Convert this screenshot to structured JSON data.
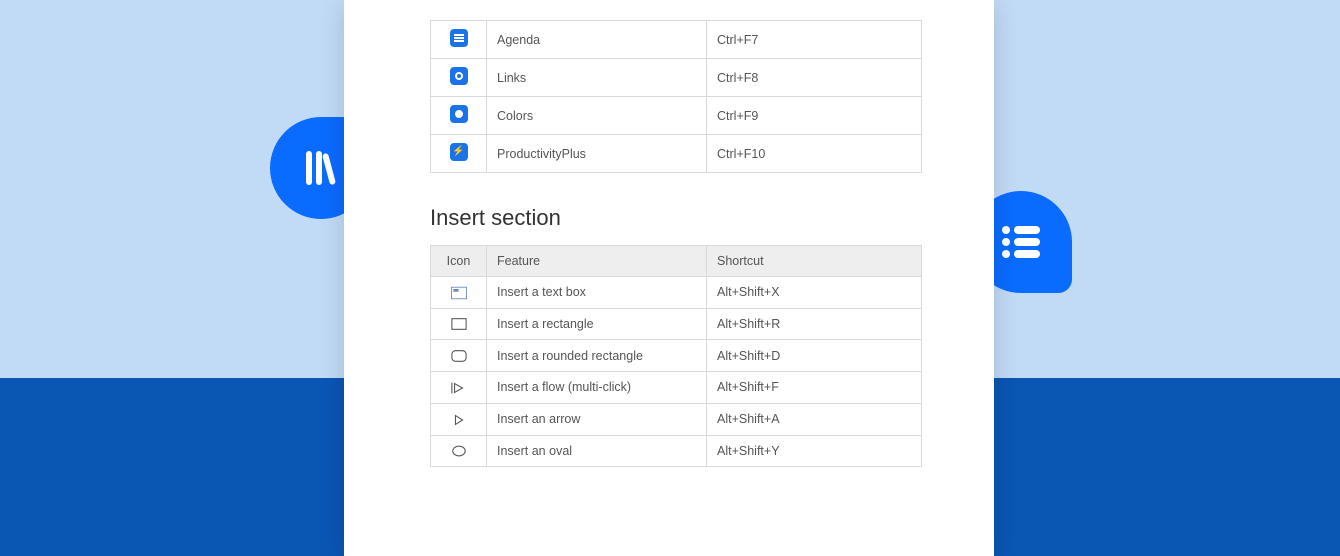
{
  "top_table": {
    "rows": [
      {
        "icon": "agenda-icon",
        "feature": "Agenda",
        "shortcut": "Ctrl+F7"
      },
      {
        "icon": "links-icon",
        "feature": "Links",
        "shortcut": "Ctrl+F8"
      },
      {
        "icon": "colors-icon",
        "feature": "Colors",
        "shortcut": "Ctrl+F9"
      },
      {
        "icon": "productivity-icon",
        "feature": "ProductivityPlus",
        "shortcut": "Ctrl+F10"
      }
    ]
  },
  "insert_section": {
    "title": "Insert section",
    "headers": {
      "icon": "Icon",
      "feature": "Feature",
      "shortcut": "Shortcut"
    },
    "rows": [
      {
        "icon": "textbox-icon",
        "feature": "Insert a text box",
        "shortcut": "Alt+Shift+X"
      },
      {
        "icon": "rectangle-icon",
        "feature": "Insert a rectangle",
        "shortcut": "Alt+Shift+R"
      },
      {
        "icon": "rounded-rectangle-icon",
        "feature": "Insert a rounded rectangle",
        "shortcut": "Alt+Shift+D"
      },
      {
        "icon": "flow-icon",
        "feature": "Insert a flow (multi-click)",
        "shortcut": "Alt+Shift+F"
      },
      {
        "icon": "arrow-icon",
        "feature": "Insert an arrow",
        "shortcut": "Alt+Shift+A"
      },
      {
        "icon": "oval-icon",
        "feature": "Insert an oval",
        "shortcut": "Alt+Shift+Y"
      }
    ]
  }
}
